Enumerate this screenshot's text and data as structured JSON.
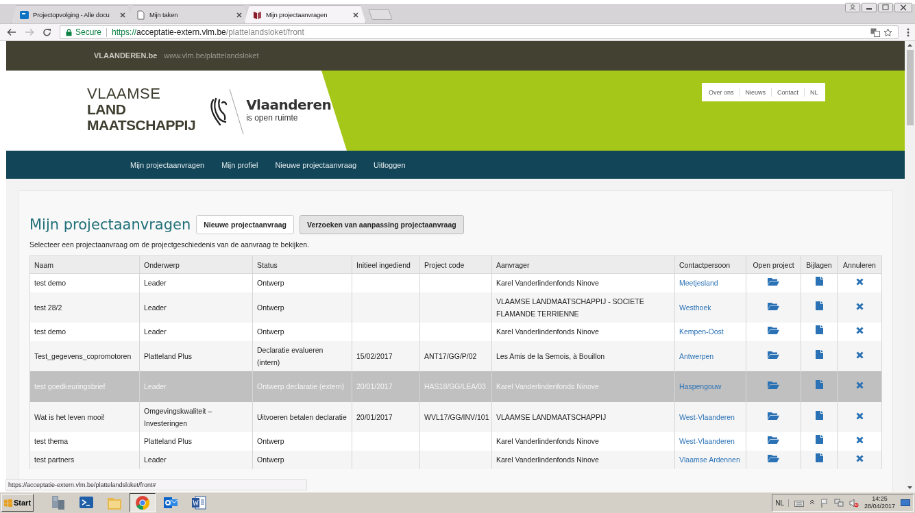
{
  "browser": {
    "tabs": [
      {
        "title": "Projectopvolging - Alle docu",
        "selected": false
      },
      {
        "title": "Mijn taken",
        "selected": false
      },
      {
        "title": "Mijn projectaanvragen",
        "selected": true
      }
    ],
    "address": {
      "secure_label": "Secure",
      "scheme": "https://",
      "host": "acceptatie-extern.vlm.be",
      "path": "/plattelandsloket/front"
    },
    "status_url": "https://acceptatie-extern.vlm.be/plattelandsloket/front#"
  },
  "site": {
    "top_bar": {
      "brand": "VLAANDEREN.be",
      "site_url": "www.vlm.be/plattelandsloket"
    },
    "logo_lines": [
      {
        "text": "VLAAMSE",
        "bold": false
      },
      {
        "text": "LAND",
        "bold": true
      },
      {
        "text": "MAATSCHAPPIJ",
        "bold": true
      }
    ],
    "flanders_logo": {
      "name": "Vlaanderen",
      "tagline": "is open ruimte"
    },
    "utility_links": [
      "Over ons",
      "Nieuws",
      "Contact",
      "NL"
    ],
    "nav": [
      "Mijn projectaanvragen",
      "Mijn profiel",
      "Nieuwe projectaanvraag",
      "Uitloggen"
    ]
  },
  "content": {
    "title": "Mijn projectaanvragen",
    "buttons": [
      {
        "label": "Nieuwe projectaanvraag",
        "kind": "plain"
      },
      {
        "label": "Verzoeken van aanpassing projectaanvraag",
        "kind": "shaded"
      }
    ],
    "intro": "Selecteer een projectaanvraag om de projectgeschiedenis van de aanvraag te bekijken.",
    "table": {
      "columns": [
        "Naam",
        "Onderwerp",
        "Status",
        "Initieel ingediend",
        "Project code",
        "Aanvrager",
        "Contactpersoon",
        "Open project",
        "Bijlagen",
        "Annuleren"
      ],
      "rows": [
        {
          "selected": false,
          "cells": [
            "test demo",
            "Leader",
            "Ontwerp",
            "",
            "",
            "Karel Vanderlindenfonds Ninove"
          ],
          "contact": "Meetjesland"
        },
        {
          "selected": false,
          "cells": [
            "test 28/2",
            "Leader",
            "Ontwerp",
            "",
            "",
            "VLAAMSE LANDMAATSCHAPPIJ - SOCIETE FLAMANDE TERRIENNE"
          ],
          "contact": "Westhoek"
        },
        {
          "selected": false,
          "cells": [
            "test demo",
            "Leader",
            "Ontwerp",
            "",
            "",
            "Karel Vanderlindenfonds Ninove"
          ],
          "contact": "Kempen-Oost"
        },
        {
          "selected": false,
          "cells": [
            "Test_gegevens_copromotoren",
            "Platteland Plus",
            "Declaratie evalueren (intern)",
            "15/02/2017",
            "ANT17/GG/P/02",
            "Les Amis de la Semois, à Bouillon"
          ],
          "contact": "Antwerpen"
        },
        {
          "selected": true,
          "cells": [
            "test goedkeuringsbrief",
            "Leader",
            "Ontwerp declaratie (extern)",
            "20/01/2017",
            "HAS18/GG/LEA/03",
            "Karel Vanderlindenfonds Ninove"
          ],
          "contact": "Haspengouw"
        },
        {
          "selected": false,
          "cells": [
            "Wat is het leven mooi!",
            "Omgevingskwaliteit – Investeringen",
            "Uitvoeren betalen declaratie",
            "20/01/2017",
            "WVL17/GG/INV/101",
            "VLAAMSE LANDMAATSCHAPPIJ"
          ],
          "contact": "West-Vlaanderen"
        },
        {
          "selected": false,
          "cells": [
            "test thema",
            "Platteland Plus",
            "Ontwerp",
            "",
            "",
            "Karel Vanderlindenfonds Ninove"
          ],
          "contact": "West-Vlaanderen"
        },
        {
          "selected": false,
          "cells": [
            "test partners",
            "Leader",
            "Ontwerp",
            "",
            "",
            "Karel Vanderlindenfonds Ninove"
          ],
          "contact": "Vlaamse Ardennen"
        }
      ]
    }
  },
  "taskbar": {
    "start": "Start",
    "language": "NL",
    "time": "14:25",
    "date": "28/04/2017"
  }
}
